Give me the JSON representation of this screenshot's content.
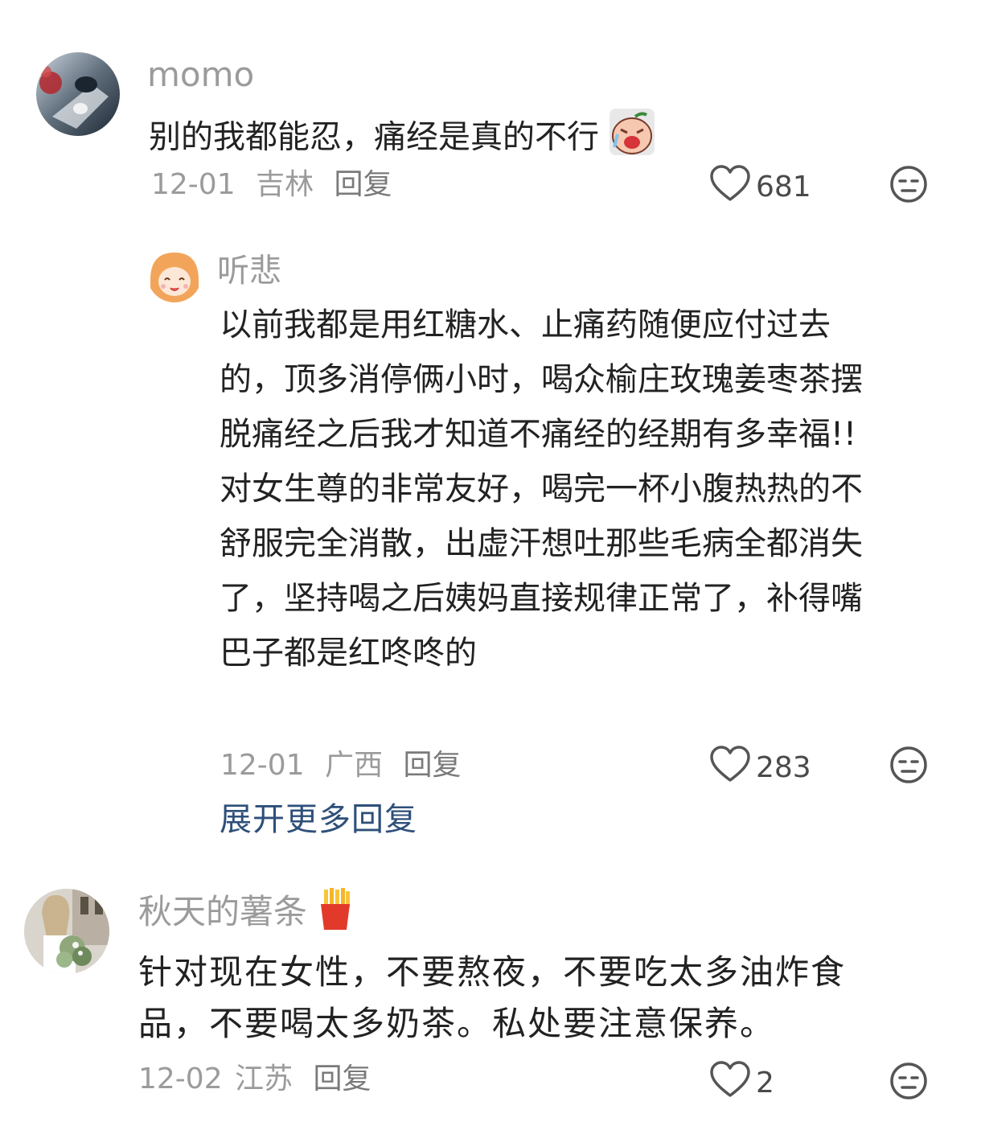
{
  "comments": [
    {
      "username": "momo",
      "text": "别的我都能忍，痛经是真的不行",
      "emoji": "crying-face-emoji",
      "date": "12-01",
      "location": "吉林",
      "reply_label": "回复",
      "likes": "681"
    },
    {
      "username": "听悲",
      "text": "以前我都是用红糖水、止痛药随便应付过去的，顶多消停俩小时，喝众榆庄玫瑰姜枣茶摆脱痛经之后我才知道不痛经的经期有多幸福!!对女生尊的非常友好，喝完一杯小腹热热的不舒服完全消散，出虚汗想吐那些毛病全都消失了，坚持喝之后姨妈直接规律正常了，补得嘴巴子都是红咚咚的",
      "date": "12-01",
      "location": "广西",
      "reply_label": "回复",
      "likes": "283"
    },
    {
      "username": "秋天的薯条",
      "username_emoji": "fries-emoji",
      "text": "针对现在女性，不要熬夜，不要吃太多油炸食品，不要喝太多奶茶。私处要注意保养。",
      "date": "12-02",
      "location": "江苏",
      "reply_label": "回复",
      "likes": "2"
    }
  ],
  "expand_replies_label": "展开更多回复",
  "colors": {
    "username": "#9b9b9b",
    "text": "#222222",
    "meta": "#9b9b9b",
    "link": "#2e4f7a"
  }
}
